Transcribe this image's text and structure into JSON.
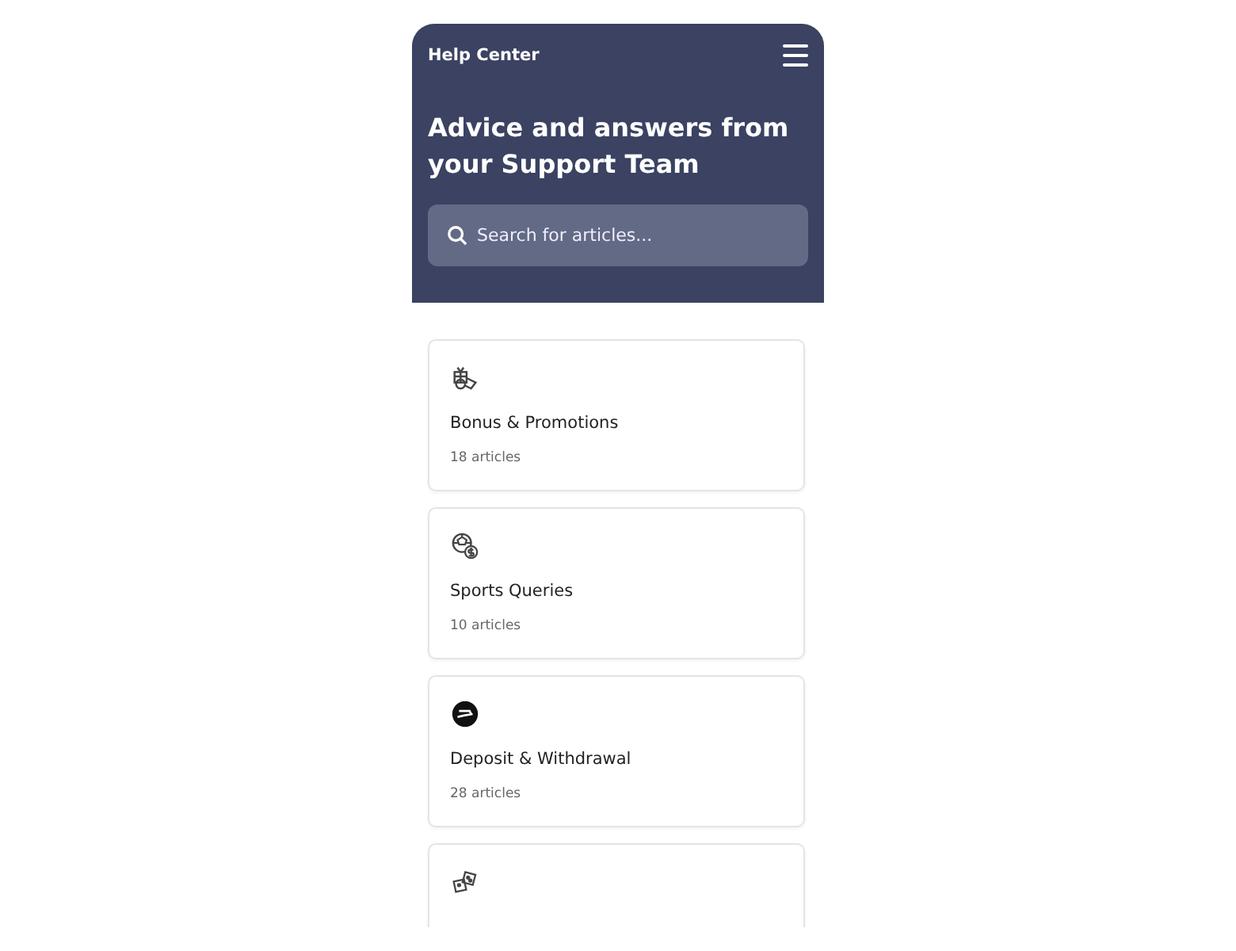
{
  "header": {
    "title": "Help Center",
    "headline": "Advice and answers from your Support Team",
    "search": {
      "placeholder": "Search for articles..."
    }
  },
  "categories": [
    {
      "kind": "gift",
      "title": "Bonus & Promotions",
      "count": "18 articles"
    },
    {
      "kind": "sports",
      "title": "Sports Queries",
      "count": "10 articles"
    },
    {
      "kind": "money",
      "title": "Deposit & Withdrawal",
      "count": "28 articles"
    },
    {
      "kind": "dice"
    }
  ]
}
